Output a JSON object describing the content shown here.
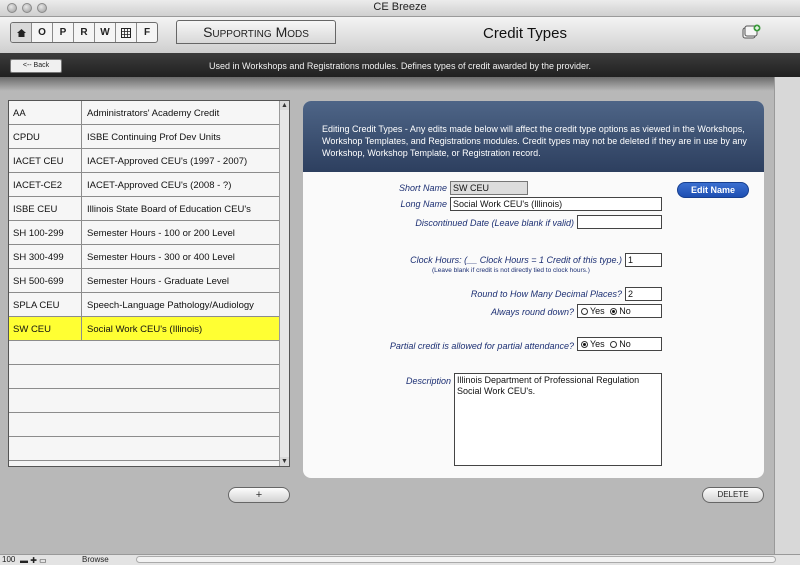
{
  "window": {
    "title": "CE Breeze"
  },
  "nav": {
    "buttons": [
      "O",
      "P",
      "R",
      "W",
      "F"
    ]
  },
  "header": {
    "module_tab": "Supporting Mods",
    "page_title": "Credit Types"
  },
  "toolbar": {
    "back_label": "<-- Back",
    "info": "Used in Workshops and Registrations modules.  Defines types of credit awarded by the provider."
  },
  "list": {
    "rows": [
      {
        "code": "AA",
        "desc": "Administrators' Academy Credit"
      },
      {
        "code": "CPDU",
        "desc": "ISBE Continuing Prof Dev Units"
      },
      {
        "code": "IACET CEU",
        "desc": "IACET-Approved CEU's (1997 - 2007)"
      },
      {
        "code": "IACET-CE2",
        "desc": "IACET-Approved CEU's (2008 - ?)"
      },
      {
        "code": "ISBE CEU",
        "desc": "Illinois State Board of Education CEU's"
      },
      {
        "code": "SH 100-299",
        "desc": "Semester Hours - 100 or 200 Level"
      },
      {
        "code": "SH 300-499",
        "desc": "Semester Hours - 300 or 400 Level"
      },
      {
        "code": "SH 500-699",
        "desc": "Semester Hours - Graduate Level"
      },
      {
        "code": "SPLA CEU",
        "desc": "Speech-Language Pathology/Audiology"
      },
      {
        "code": "SW CEU",
        "desc": "Social Work CEU's (Illinois)"
      }
    ],
    "selected_index": 9,
    "plus_label": "+",
    "delete_label": "DELETE"
  },
  "editor": {
    "header_text": "Editing Credit Types - Any edits made below will affect the credit type options as viewed in the Workshops, Workshop Templates, and Registrations modules.  Credit types may not be deleted if they are in use by any Workshop, Workshop Template, or Registration record.",
    "short_name_label": "Short Name",
    "short_name": "SW CEU",
    "edit_name_label": "Edit Name",
    "long_name_label": "Long Name",
    "long_name": "Social Work CEU's (Illinois)",
    "discontinued_label": "Discontinued Date (Leave blank if valid)",
    "discontinued": "",
    "clock_hours_label": "Clock Hours:  (__ Clock Hours = 1 Credit of this type.)",
    "clock_hours_note": "(Leave blank if credit is not directly tied to clock hours.)",
    "clock_hours": "1",
    "round_label": "Round to How Many Decimal Places?",
    "round": "2",
    "always_round_label": "Always round down?",
    "always_round_options": [
      "Yes",
      "No"
    ],
    "always_round_selected": "No",
    "partial_label": "Partial credit is allowed for partial attendance?",
    "partial_options": [
      "Yes",
      "No"
    ],
    "partial_selected": "Yes",
    "description_label": "Description",
    "description": "Illinois Department of Professional Regulation Social Work CEU's."
  },
  "status": {
    "zoom": "100",
    "mode": "Browse"
  }
}
